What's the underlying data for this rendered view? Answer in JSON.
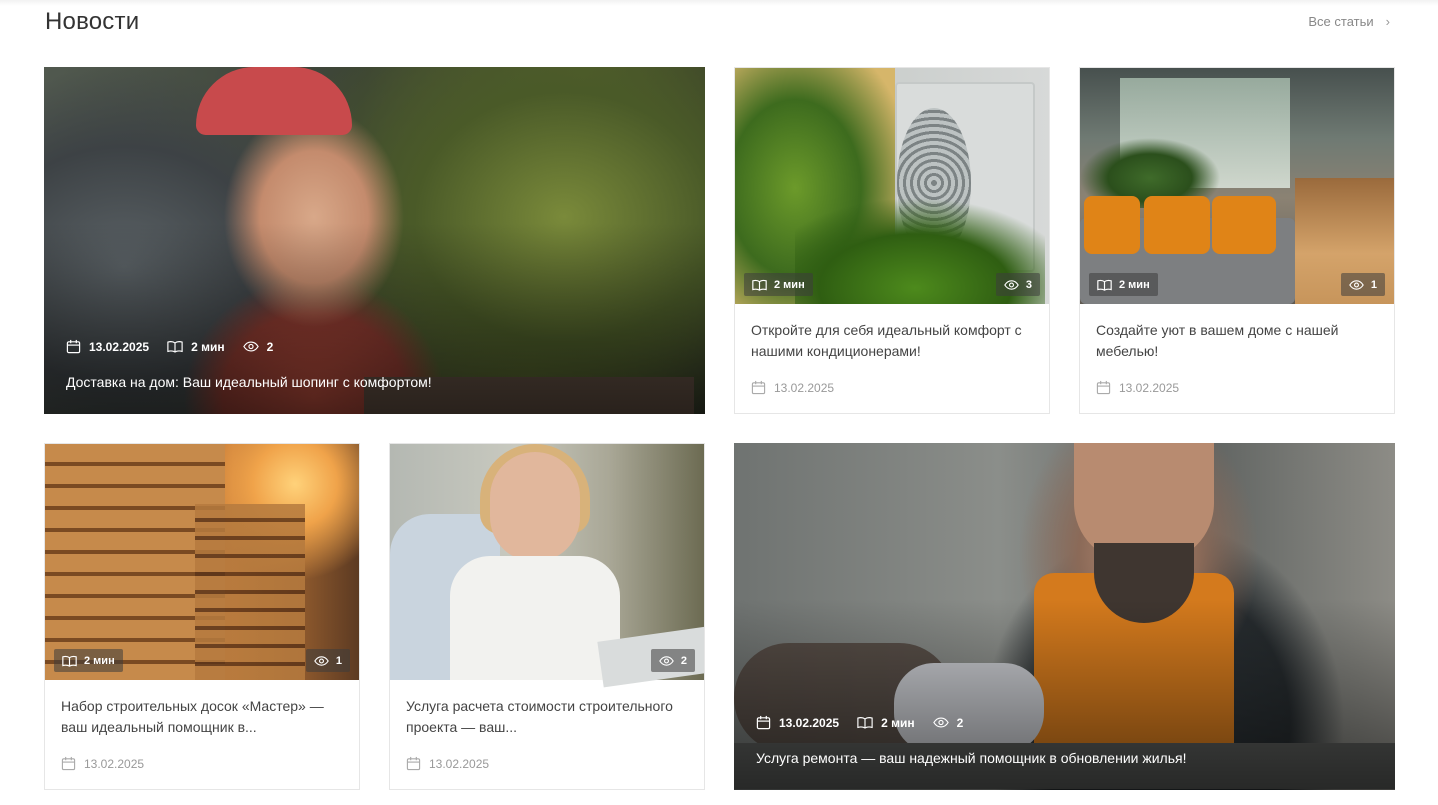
{
  "section": {
    "title": "Новости",
    "all_link": "Все статьи"
  },
  "icons": {
    "calendar": "calendar-icon",
    "reading_time": "book-icon",
    "views": "eye-icon",
    "chevron": "chevron-right-icon"
  },
  "colors": {
    "title": "#333333",
    "muted": "#999999",
    "card_border": "#e6e6e6",
    "badge_bg": "rgba(60,60,60,0.55)"
  },
  "cards": [
    {
      "title": "Доставка на дом: Ваш идеальный шопинг с комфортом!",
      "date": "13.02.2025",
      "read_time": "2 мин",
      "views": "2"
    },
    {
      "title": "Откройте для себя идеальный комфорт с нашими кондиционерами!",
      "date": "13.02.2025",
      "read_time": "2 мин",
      "views": "3"
    },
    {
      "title": "Создайте уют в вашем доме с нашей мебелью!",
      "date": "13.02.2025",
      "read_time": "2 мин",
      "views": "1"
    },
    {
      "title": "Набор строительных досок «Мастер» — ваш идеальный помощник в...",
      "date": "13.02.2025",
      "read_time": "2 мин",
      "views": "1"
    },
    {
      "title": "Услуга расчета стоимости строительного проекта — ваш...",
      "date": "13.02.2025",
      "views": "2"
    },
    {
      "title": "Услуга ремонта — ваш надежный помощник в обновлении жилья!",
      "date": "13.02.2025",
      "read_time": "2 мин",
      "views": "2"
    }
  ]
}
